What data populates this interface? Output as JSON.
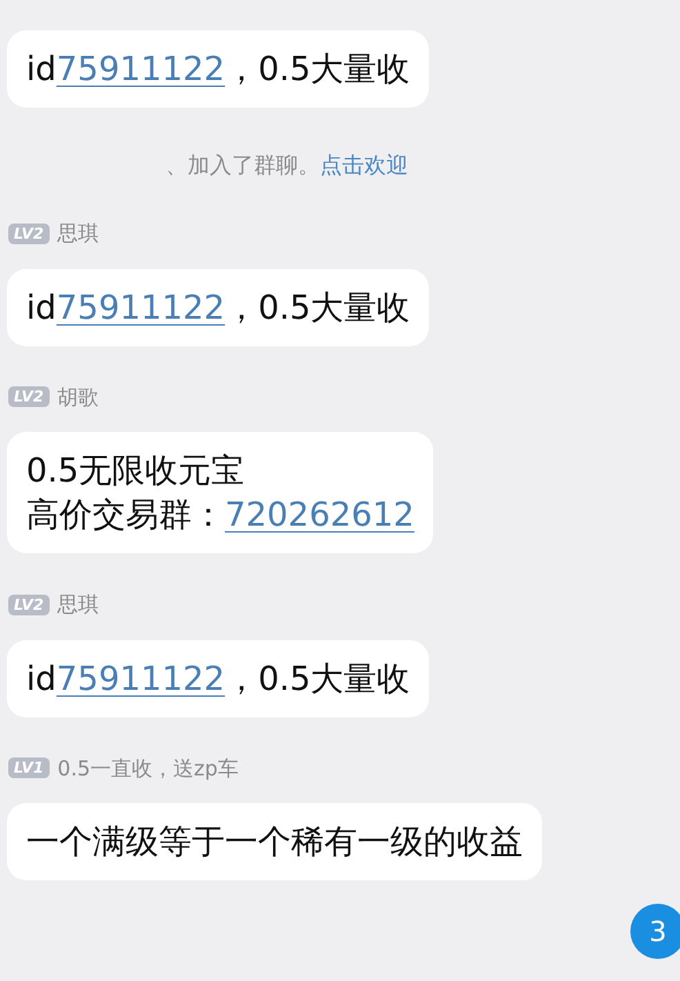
{
  "items": [
    {
      "kind": "message",
      "bubble": {
        "lines": [
          [
            {
              "kind": "text",
              "text": "id"
            },
            {
              "kind": "link",
              "text": "75911122"
            },
            {
              "kind": "text",
              "text": "，0.5大量收"
            }
          ]
        ]
      }
    },
    {
      "kind": "notice",
      "parts": [
        {
          "kind": "text",
          "text": "、加入了群聊。"
        },
        {
          "kind": "link",
          "text": "点击欢迎"
        }
      ]
    },
    {
      "kind": "message",
      "sender": {
        "level": "LV2",
        "name": "思琪"
      },
      "bubble": {
        "lines": [
          [
            {
              "kind": "text",
              "text": "id"
            },
            {
              "kind": "link",
              "text": "75911122"
            },
            {
              "kind": "text",
              "text": "，0.5大量收"
            }
          ]
        ]
      }
    },
    {
      "kind": "message",
      "sender": {
        "level": "LV2",
        "name": "胡歌"
      },
      "bubble": {
        "lines": [
          [
            {
              "kind": "text",
              "text": "0.5无限收元宝"
            }
          ],
          [
            {
              "kind": "text",
              "text": "高价交易群："
            },
            {
              "kind": "link",
              "text": "720262612"
            }
          ]
        ]
      }
    },
    {
      "kind": "message",
      "sender": {
        "level": "LV2",
        "name": "思琪"
      },
      "bubble": {
        "lines": [
          [
            {
              "kind": "text",
              "text": "id"
            },
            {
              "kind": "link",
              "text": "75911122"
            },
            {
              "kind": "text",
              "text": "，0.5大量收"
            }
          ]
        ]
      }
    },
    {
      "kind": "message",
      "sender": {
        "level": "LV1",
        "name": "0.5一直收，送zp车"
      },
      "bubble": {
        "lines": [
          [
            {
              "kind": "text",
              "text": "一个满级等于一个稀有一级的收益"
            }
          ]
        ]
      }
    }
  ],
  "unread_badge": "3"
}
